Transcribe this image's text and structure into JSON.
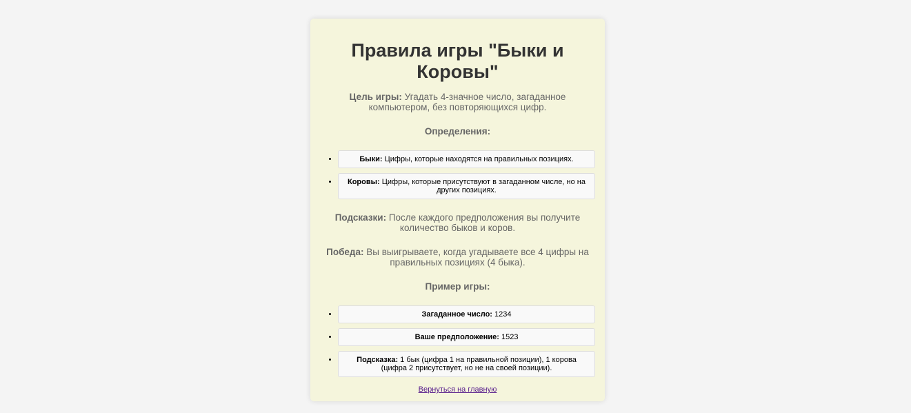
{
  "title": "Правила игры \"Быки и Коровы\"",
  "goal": {
    "label": "Цель игры:",
    "text": " Угадать 4-значное число, загаданное компьютером, без повторяющихся цифр."
  },
  "definitions": {
    "heading": "Определения:",
    "items": [
      {
        "term": "Быки:",
        "text": " Цифры, которые находятся на правильных позициях."
      },
      {
        "term": "Коровы:",
        "text": " Цифры, которые присутствуют в загаданном числе, но на других позициях."
      }
    ]
  },
  "hints": {
    "label": "Подсказки:",
    "text": " После каждого предположения вы получите количество быков и коров."
  },
  "win": {
    "label": "Победа:",
    "text": " Вы выигрываете, когда угадываете все 4 цифры на правильных позициях (4 быка)."
  },
  "example": {
    "heading": "Пример игры:",
    "items": [
      {
        "term": "Загаданное число:",
        "text": " 1234"
      },
      {
        "term": "Ваше предположение:",
        "text": " 1523"
      },
      {
        "term": "Подсказка:",
        "text": " 1 бык (цифра 1 на правильной позиции), 1 корова (цифра 2 присутствует, но не на своей позиции)."
      }
    ]
  },
  "back_link": "Вернуться на главную",
  "colors": {
    "page_bg": "#f4f4f4",
    "card_bg": "#f5f5dc",
    "link": "#551a8b"
  }
}
